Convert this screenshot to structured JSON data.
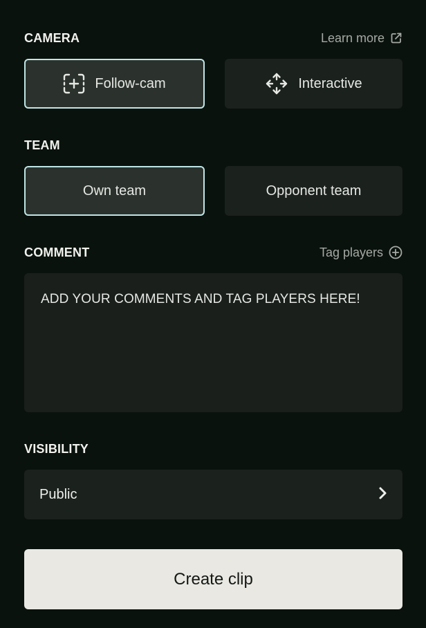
{
  "camera": {
    "title": "CAMERA",
    "link_label": "Learn more",
    "options": [
      {
        "label": "Follow-cam",
        "icon": "follow-cam-icon",
        "selected": true
      },
      {
        "label": "Interactive",
        "icon": "move-arrows-icon",
        "selected": false
      }
    ]
  },
  "team": {
    "title": "TEAM",
    "options": [
      {
        "label": "Own team",
        "selected": true
      },
      {
        "label": "Opponent team",
        "selected": false
      }
    ]
  },
  "comment": {
    "title": "COMMENT",
    "link_label": "Tag players",
    "placeholder": "ADD YOUR COMMENTS AND TAG PLAYERS HERE!"
  },
  "visibility": {
    "title": "VISIBILITY",
    "value": "Public"
  },
  "primary_action": {
    "label": "Create clip"
  },
  "colors": {
    "background": "#0a120d",
    "card": "#1b211d",
    "selected_card": "#2b322d",
    "selected_border": "#bfe6e6",
    "primary_button": "#e9e8e3"
  }
}
